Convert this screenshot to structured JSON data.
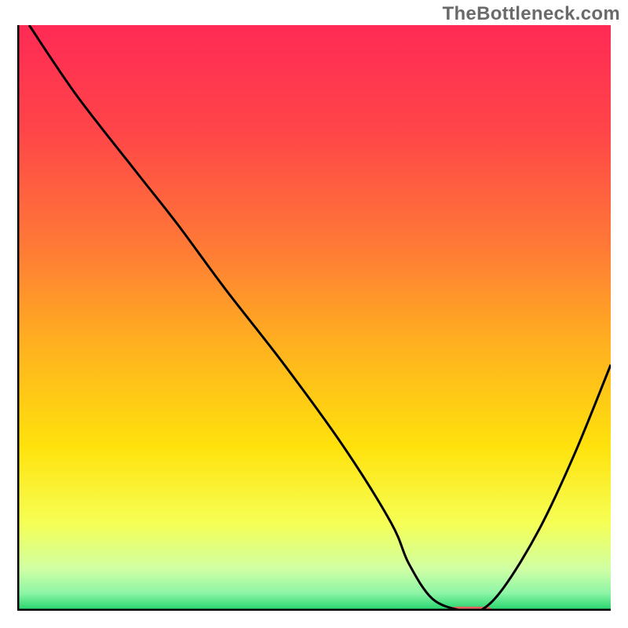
{
  "watermark": "TheBottleneck.com",
  "chart_data": {
    "type": "line",
    "title": "",
    "xlabel": "",
    "ylabel": "",
    "xlim": [
      0,
      100
    ],
    "ylim": [
      0,
      100
    ],
    "grid": false,
    "legend": false,
    "background_gradient": {
      "stops": [
        {
          "offset": 0.0,
          "color": "#ff2a55"
        },
        {
          "offset": 0.18,
          "color": "#ff4549"
        },
        {
          "offset": 0.38,
          "color": "#ff7a36"
        },
        {
          "offset": 0.55,
          "color": "#ffb21f"
        },
        {
          "offset": 0.72,
          "color": "#ffe20c"
        },
        {
          "offset": 0.85,
          "color": "#f6ff55"
        },
        {
          "offset": 0.93,
          "color": "#cfffa5"
        },
        {
          "offset": 0.97,
          "color": "#8cf5a6"
        },
        {
          "offset": 1.0,
          "color": "#1fd36b"
        }
      ]
    },
    "series": [
      {
        "name": "bottleneck-curve",
        "color": "#000000",
        "x": [
          2,
          10,
          20,
          27,
          35,
          45,
          55,
          63,
          66,
          70,
          75,
          78,
          82,
          88,
          94,
          100
        ],
        "y": [
          100,
          88,
          75,
          66,
          55,
          42,
          28,
          15,
          8,
          2,
          0,
          0,
          4,
          14,
          27,
          42
        ]
      }
    ],
    "marker": {
      "name": "optimal-region",
      "shape": "rounded-rect",
      "color": "#e4675f",
      "x_range": [
        73,
        80
      ],
      "y": 0,
      "height_pct": 1.4
    }
  }
}
